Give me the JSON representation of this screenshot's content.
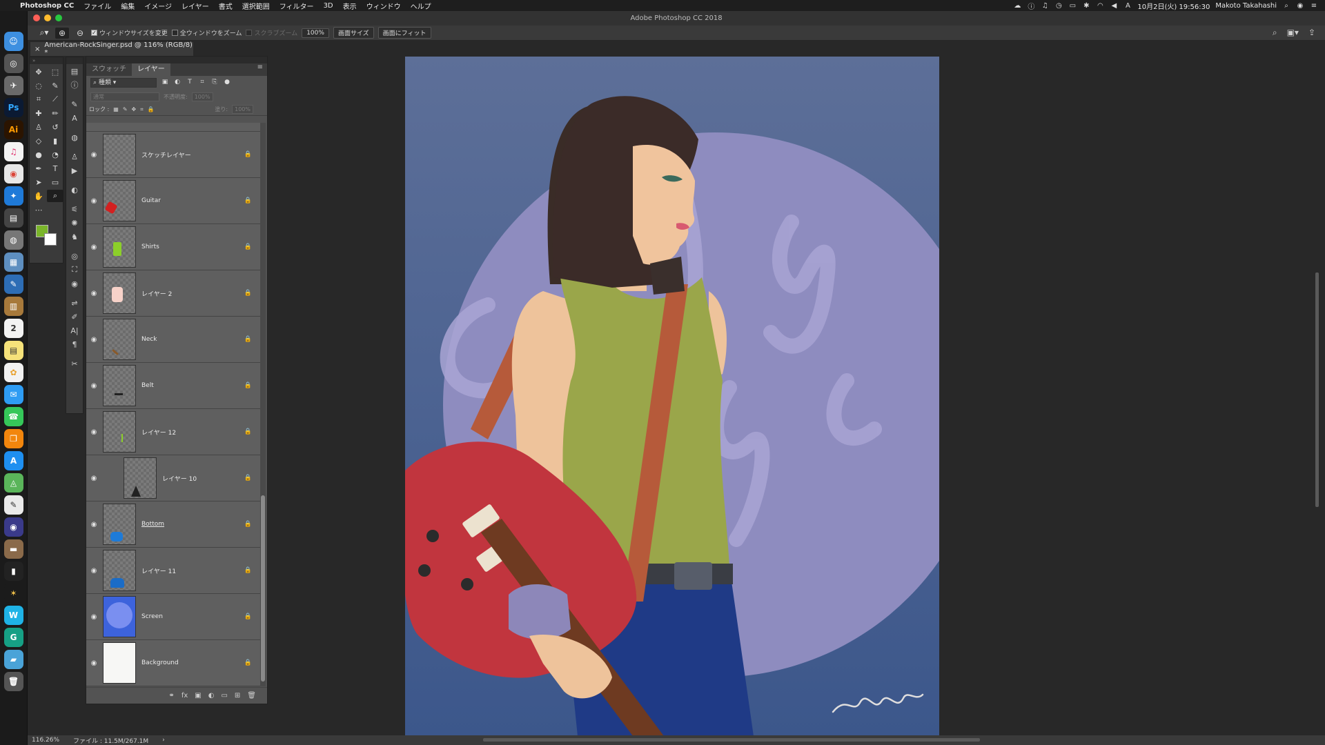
{
  "menubar": {
    "app_name": "Photoshop CC",
    "items": [
      "ファイル",
      "編集",
      "イメージ",
      "レイヤー",
      "書式",
      "選択範囲",
      "フィルター",
      "3D",
      "表示",
      "ウィンドウ",
      "ヘルプ"
    ],
    "datetime": "10月2日(火) 19:56:30",
    "user": "Makoto Takahashi"
  },
  "window": {
    "title": "Adobe Photoshop CC 2018"
  },
  "options": {
    "resize_windows_label": "ウィンドウサイズを変更",
    "zoom_all_windows_label": "全ウィンドウをズーム",
    "scrubby_zoom_label": "スクラブズーム",
    "zoom_value": "100%",
    "fit_screen_label": "画面サイズ",
    "fill_screen_label": "画面にフィット"
  },
  "document": {
    "tab_title": "American-RockSinger.psd @ 116% (RGB/8) *"
  },
  "panel": {
    "tabs": [
      "スウォッチ",
      "レイヤー"
    ],
    "active_tab": "レイヤー",
    "filter_kind": "種類",
    "blend_mode": "通常",
    "opacity_label": "不透明度:",
    "opacity_value": "100%",
    "lock_label": "ロック :",
    "fill_label": "塗り:",
    "fill_value": "100%"
  },
  "layers": [
    {
      "name": "スケッチレイヤー"
    },
    {
      "name": "Guitar"
    },
    {
      "name": "Shirts"
    },
    {
      "name": "レイヤー 2"
    },
    {
      "name": "Neck"
    },
    {
      "name": "Belt"
    },
    {
      "name": "レイヤー 12"
    },
    {
      "name": "レイヤー 10"
    },
    {
      "name": "Bottom"
    },
    {
      "name": "レイヤー 11"
    },
    {
      "name": "Screen"
    },
    {
      "name": "Background"
    }
  ],
  "status": {
    "zoom": "116.26%",
    "file_info": "ファイル : 11.5M/267.1M"
  },
  "colors": {
    "foreground": "#7ab52a",
    "background": "#ffffff"
  }
}
